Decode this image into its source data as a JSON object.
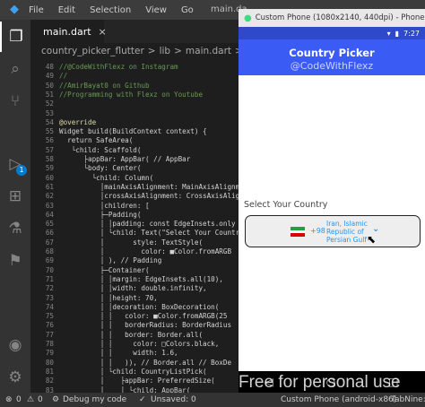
{
  "titlebar": {
    "menus": [
      "File",
      "Edit",
      "Selection",
      "View",
      "Go"
    ],
    "window_title": "main.da"
  },
  "activity_badge": "1",
  "tab": {
    "label": "main.dart",
    "close": "×"
  },
  "breadcrumb": [
    "country_picker_flutter",
    ">",
    "lib",
    ">",
    "main.dart",
    ">"
  ],
  "code_lines": [
    {
      "n": "48",
      "text": "//@CodeWithFlexz on Instagram",
      "cls": "c-comment"
    },
    {
      "n": "49",
      "text": "//",
      "cls": "c-comment"
    },
    {
      "n": "50",
      "text": "//AmirBayat0 on Github",
      "cls": "c-comment"
    },
    {
      "n": "51",
      "text": "//Programming with Flexz on Youtube",
      "cls": "c-comment"
    },
    {
      "n": "52",
      "text": "",
      "cls": "c-comment"
    },
    {
      "n": "53",
      "text": "",
      "cls": "src"
    },
    {
      "n": "54",
      "text": "@override",
      "cls": "c-ann"
    },
    {
      "n": "55",
      "text": "Widget build(BuildContext context) {",
      "cls": "src"
    },
    {
      "n": "56",
      "text": "  return SafeArea(",
      "cls": "src"
    },
    {
      "n": "57",
      "text": "   └child: Scaffold(",
      "cls": "src"
    },
    {
      "n": "58",
      "text": "      ├appBar: AppBar( // AppBar",
      "cls": "src"
    },
    {
      "n": "59",
      "text": "      └body: Center(",
      "cls": "src"
    },
    {
      "n": "60",
      "text": "        └child: Column(",
      "cls": "src"
    },
    {
      "n": "61",
      "text": "          │mainAxisAlignment: MainAxisAlignmen",
      "cls": "src"
    },
    {
      "n": "62",
      "text": "          │crossAxisAlignment: CrossAxisAlignm",
      "cls": "src"
    },
    {
      "n": "63",
      "text": "          │children: [",
      "cls": "src"
    },
    {
      "n": "64",
      "text": "          ├─Padding(",
      "cls": "src"
    },
    {
      "n": "65",
      "text": "          │ │padding: const EdgeInsets.only",
      "cls": "src"
    },
    {
      "n": "66",
      "text": "          │ └child: Text(\"Select Your Countr",
      "cls": "src"
    },
    {
      "n": "67",
      "text": "          │       style: TextStyle(",
      "cls": "src"
    },
    {
      "n": "68",
      "text": "          │         color: ■Color.fromARGB",
      "cls": "src"
    },
    {
      "n": "69",
      "text": "          │ ), // Padding",
      "cls": "src"
    },
    {
      "n": "70",
      "text": "          ├─Container(",
      "cls": "src"
    },
    {
      "n": "71",
      "text": "          │ │margin: EdgeInsets.all(10),",
      "cls": "src"
    },
    {
      "n": "72",
      "text": "          │ │width: double.infinity,",
      "cls": "src"
    },
    {
      "n": "73",
      "text": "          │ │height: 70,",
      "cls": "src"
    },
    {
      "n": "74",
      "text": "          │ │decoration: BoxDecoration(",
      "cls": "src"
    },
    {
      "n": "75",
      "text": "          │ │   color: ■Color.fromARGB(25",
      "cls": "src"
    },
    {
      "n": "76",
      "text": "          │ │   borderRadius: BorderRadius",
      "cls": "src"
    },
    {
      "n": "77",
      "text": "          │ │   border: Border.all(",
      "cls": "src"
    },
    {
      "n": "78",
      "text": "          │ │     color: □Colors.black,",
      "cls": "src"
    },
    {
      "n": "79",
      "text": "          │ │     width: 1.6,",
      "cls": "src"
    },
    {
      "n": "80",
      "text": "          │ │   )), // Border.all // BoxDe",
      "cls": "src"
    },
    {
      "n": "81",
      "text": "          │ └child: CountryListPick(",
      "cls": "src"
    },
    {
      "n": "82",
      "text": "          │    ├appBar: PreferredSize(",
      "cls": "src"
    },
    {
      "n": "83",
      "text": "          │    │ └child: AppBar(",
      "cls": "src"
    },
    {
      "n": "84",
      "text": "          │    │    ├title: Text(\"Select Coun",
      "cls": "src"
    },
    {
      "n": "85",
      "text": "          │    │    │backgroundColor: □Col",
      "cls": "src"
    }
  ],
  "emulator": {
    "window_title": "Custom Phone (1080x2140, 440dpi) - Phone (emulat",
    "clock": "7:27",
    "app_title": "Country Picker",
    "app_subtitle": "@CodeWithFlexz",
    "label": "Select Your Country",
    "dial_code": "+98",
    "country_name": "Iran, Islamic Republic of Persian Gulf",
    "flag_colors": [
      "#239f40",
      "#ffffff",
      "#da0000"
    ]
  },
  "watermark": "Free for personal use",
  "status": {
    "errors": "0",
    "warnings": "0",
    "debug": "Debug my code",
    "unsaved": "Unsaved: 0",
    "device": "Custom Phone (android-x86)",
    "tabnine": "TabNine:"
  },
  "colors": {
    "accent": "#3b5bf5",
    "statusbar_blue": "#2e49c9",
    "link_blue": "#2196f3"
  }
}
